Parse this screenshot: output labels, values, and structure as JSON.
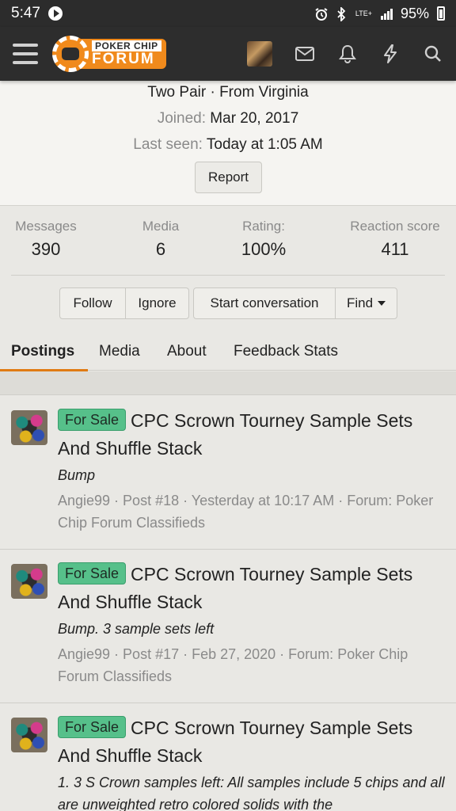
{
  "statusbar": {
    "time": "5:47",
    "network": "LTE+",
    "battery": "95%"
  },
  "header": {
    "logo_top": "POKER CHIP",
    "logo_bottom": "FORUM"
  },
  "profile": {
    "tagline": "Two Pair · From Virginia",
    "joined_label": "Joined:",
    "joined_value": "Mar 20, 2017",
    "lastseen_label": "Last seen:",
    "lastseen_value": "Today at 1:05 AM",
    "report": "Report"
  },
  "stats": [
    {
      "label": "Messages",
      "value": "390"
    },
    {
      "label": "Media",
      "value": "6"
    },
    {
      "label": "Rating:",
      "value": "100%"
    },
    {
      "label": "Reaction score",
      "value": "411"
    }
  ],
  "actions": {
    "follow": "Follow",
    "ignore": "Ignore",
    "start_conversation": "Start conversation",
    "find": "Find"
  },
  "tabs": [
    "Postings",
    "Media",
    "About",
    "Feedback Stats"
  ],
  "posts": [
    {
      "badge": "For Sale",
      "title": "CPC Scrown Tourney Sample Sets And Shuffle Stack",
      "snippet": "Bump",
      "meta": "Angie99 · Post #18 · Yesterday at 10:17 AM · Forum: Poker Chip Forum Classifieds"
    },
    {
      "badge": "For Sale",
      "title": "CPC Scrown Tourney Sample Sets And Shuffle Stack",
      "snippet": "Bump. 3 sample sets left",
      "meta": "Angie99 · Post #17 · Feb 27, 2020 · Forum: Poker Chip Forum Classifieds"
    },
    {
      "badge": "For Sale",
      "title": "CPC Scrown Tourney Sample Sets And Shuffle Stack",
      "snippet": "1. 3 S Crown samples left: All samples include 5 chips and all are unweighted retro colored solids with the",
      "meta": ""
    }
  ],
  "colors": {
    "accent": "#e07b13",
    "badge": "#56c08a",
    "header": "#2d2d2d"
  }
}
